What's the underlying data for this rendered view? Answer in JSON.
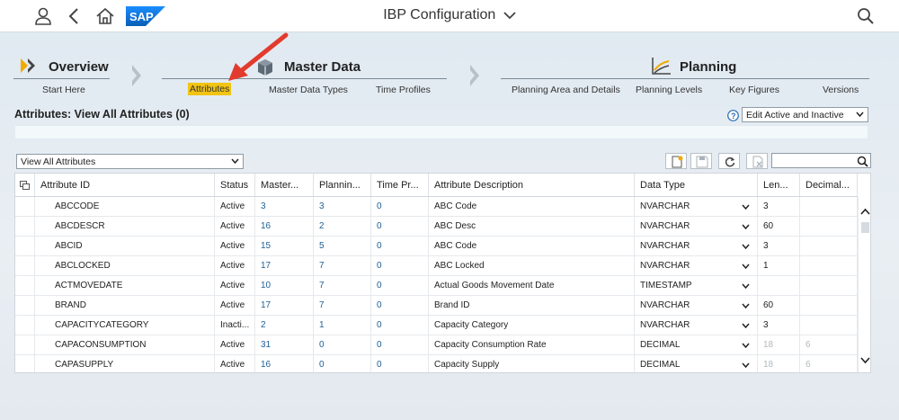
{
  "shell": {
    "title": "IBP Configuration",
    "logo_text": "SAP",
    "icons": [
      "user-icon",
      "back-icon",
      "home-icon",
      "search-icon"
    ]
  },
  "nav": {
    "overview": {
      "title": "Overview",
      "subs": [
        "Start Here"
      ]
    },
    "master_data": {
      "title": "Master Data",
      "subs": [
        "Attributes",
        "Master Data Types",
        "Time Profiles"
      ],
      "active": "Attributes"
    },
    "planning": {
      "title": "Planning",
      "subs": [
        "Planning Area and Details",
        "Planning Levels",
        "Key Figures",
        "Versions"
      ]
    }
  },
  "section": {
    "title": "Attributes: View All Attributes (0)",
    "mode_select": "Edit Active and Inactive",
    "view_select": "View All Attributes",
    "search_placeholder": ""
  },
  "table": {
    "columns": [
      "Attribute ID",
      "Status",
      "Master...",
      "Plannin...",
      "Time Pr...",
      "Attribute Description",
      "Data Type",
      "Len...",
      "Decimal..."
    ],
    "rows": [
      {
        "id": "ABCCODE",
        "status": "Active",
        "master": "3",
        "planning": "3",
        "time": "0",
        "desc": "ABC Code",
        "type": "NVARCHAR",
        "len": "3",
        "dec": "",
        "len_disabled": false
      },
      {
        "id": "ABCDESCR",
        "status": "Active",
        "master": "16",
        "planning": "2",
        "time": "0",
        "desc": "ABC Desc",
        "type": "NVARCHAR",
        "len": "60",
        "dec": "",
        "len_disabled": false
      },
      {
        "id": "ABCID",
        "status": "Active",
        "master": "15",
        "planning": "5",
        "time": "0",
        "desc": "ABC Code",
        "type": "NVARCHAR",
        "len": "3",
        "dec": "",
        "len_disabled": false
      },
      {
        "id": "ABCLOCKED",
        "status": "Active",
        "master": "17",
        "planning": "7",
        "time": "0",
        "desc": "ABC Locked",
        "type": "NVARCHAR",
        "len": "1",
        "dec": "",
        "len_disabled": false
      },
      {
        "id": "ACTMOVEDATE",
        "status": "Active",
        "master": "10",
        "planning": "7",
        "time": "0",
        "desc": "Actual Goods Movement Date",
        "type": "TIMESTAMP",
        "len": "",
        "dec": "",
        "len_disabled": false
      },
      {
        "id": "BRAND",
        "status": "Active",
        "master": "17",
        "planning": "7",
        "time": "0",
        "desc": "Brand ID",
        "type": "NVARCHAR",
        "len": "60",
        "dec": "",
        "len_disabled": false
      },
      {
        "id": "CAPACITYCATEGORY",
        "status": "Inacti...",
        "master": "2",
        "planning": "1",
        "time": "0",
        "desc": "Capacity Category",
        "type": "NVARCHAR",
        "len": "3",
        "dec": "",
        "len_disabled": false
      },
      {
        "id": "CAPACONSUMPTION",
        "status": "Active",
        "master": "31",
        "planning": "0",
        "time": "0",
        "desc": "Capacity Consumption Rate",
        "type": "DECIMAL",
        "len": "18",
        "dec": "6",
        "len_disabled": true
      },
      {
        "id": "CAPASUPPLY",
        "status": "Active",
        "master": "16",
        "planning": "0",
        "time": "0",
        "desc": "Capacity Supply",
        "type": "DECIMAL",
        "len": "18",
        "dec": "6",
        "len_disabled": true
      }
    ]
  },
  "colors": {
    "accent": "#f2c413",
    "link": "#1f5e95",
    "arrow": "#e23b2e",
    "sap_blue": "#0a6ed1"
  }
}
